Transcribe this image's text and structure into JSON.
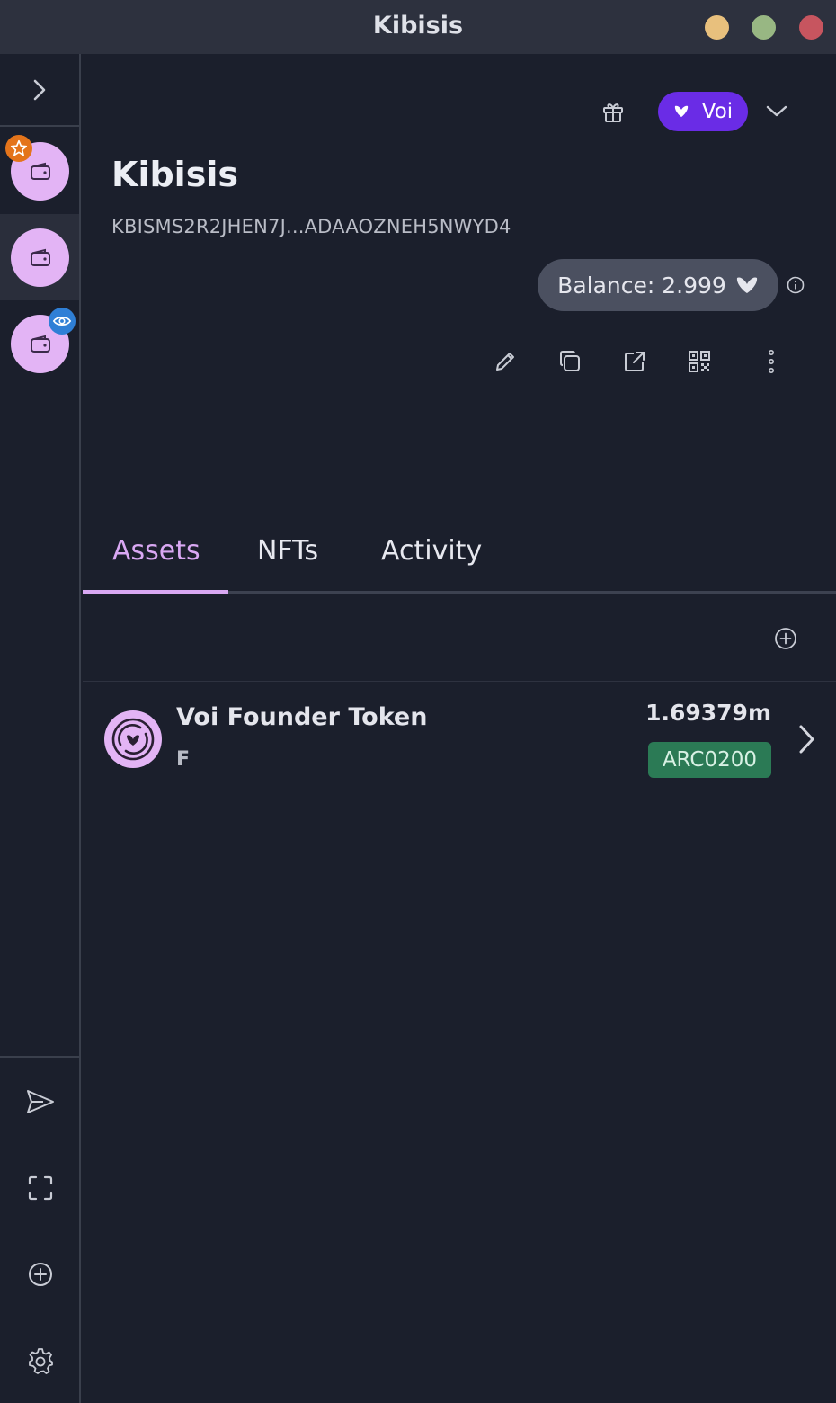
{
  "window": {
    "title": "Kibisis",
    "buttons": {
      "minimize": "#e8c07d",
      "maximize": "#98b783",
      "close": "#c7555f"
    }
  },
  "sidebar": {
    "toggle_icon": "chevron-right-icon",
    "accounts": [
      {
        "icon": "wallet-icon",
        "badge": "star-icon",
        "badge_color": "#e4741b",
        "active": false
      },
      {
        "icon": "wallet-icon",
        "badge": null,
        "active": true
      },
      {
        "icon": "wallet-icon",
        "badge": "eye-icon",
        "badge_color": "#2f7fd6",
        "active": false
      }
    ],
    "actions": [
      "send-icon",
      "scan-icon",
      "add-account-icon",
      "settings-icon"
    ]
  },
  "header": {
    "network": {
      "label": "Voi",
      "color": "#6a2ce6"
    }
  },
  "account": {
    "name": "Kibisis",
    "address": "KBISMS2R2JHEN7J...ADAAOZNEH5NWYD4",
    "balance_label": "Balance: 2.999"
  },
  "tabs": [
    {
      "label": "Assets",
      "active": true
    },
    {
      "label": "NFTs",
      "active": false
    },
    {
      "label": "Activity",
      "active": false
    }
  ],
  "assets": [
    {
      "name": "Voi Founder Token",
      "unit": "F",
      "amount": "1.69379m",
      "standard": "ARC0200"
    }
  ],
  "colors": {
    "accent": "#d9a8f3",
    "background": "#1b1f2c",
    "pill": "#4b5060",
    "tag": "#2b7a55"
  }
}
